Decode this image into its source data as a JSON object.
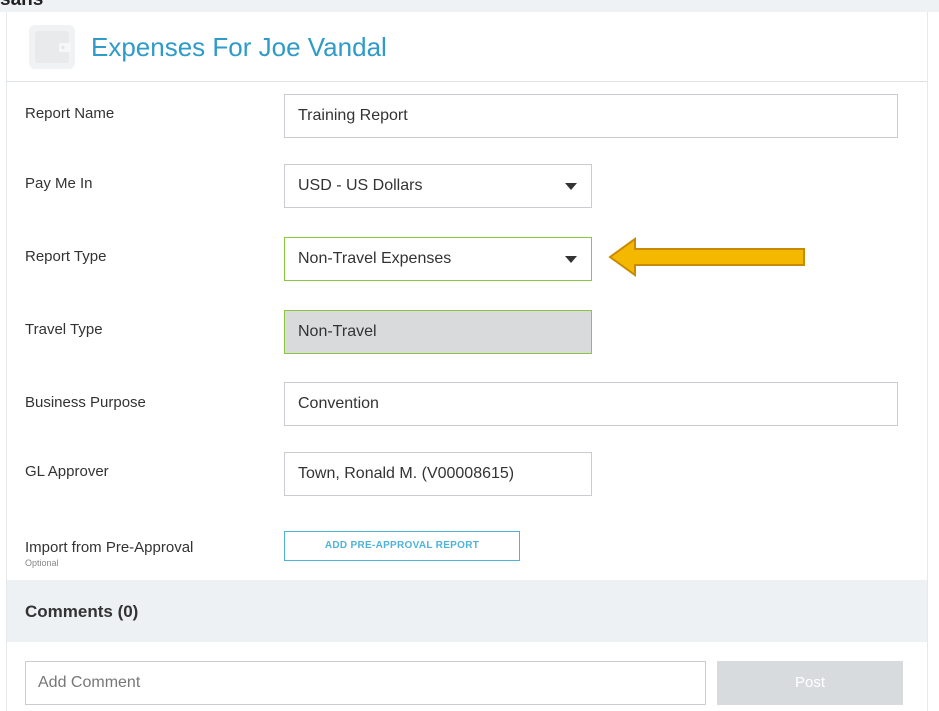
{
  "page": {
    "top_cut_text": "sans",
    "title": "Expenses For Joe Vandal",
    "header_icon": "wallet-icon"
  },
  "form": {
    "report_name": {
      "label": "Report Name",
      "value": "Training Report"
    },
    "pay_me_in": {
      "label": "Pay Me In",
      "value": "USD - US Dollars"
    },
    "report_type": {
      "label": "Report Type",
      "value": "Non-Travel Expenses"
    },
    "travel_type": {
      "label": "Travel Type",
      "value": "Non-Travel"
    },
    "business_purpose": {
      "label": "Business Purpose",
      "value": "Convention"
    },
    "gl_approver": {
      "label": "GL Approver",
      "value": "Town, Ronald M. (V00008615)"
    },
    "import_pre_approval": {
      "label": "Import from Pre-Approval",
      "optional": "Optional",
      "button_label": "ADD PRE-APPROVAL REPORT"
    }
  },
  "comments": {
    "title": "Comments  (0)",
    "placeholder": "Add Comment",
    "post_label": "Post"
  },
  "annotation": {
    "icon": "arrow-left-icon",
    "color": "#f5b800"
  },
  "colors": {
    "accent": "#2f9bc8",
    "highlight_border": "#8cc63f",
    "button_accent": "#4fb3d9"
  }
}
